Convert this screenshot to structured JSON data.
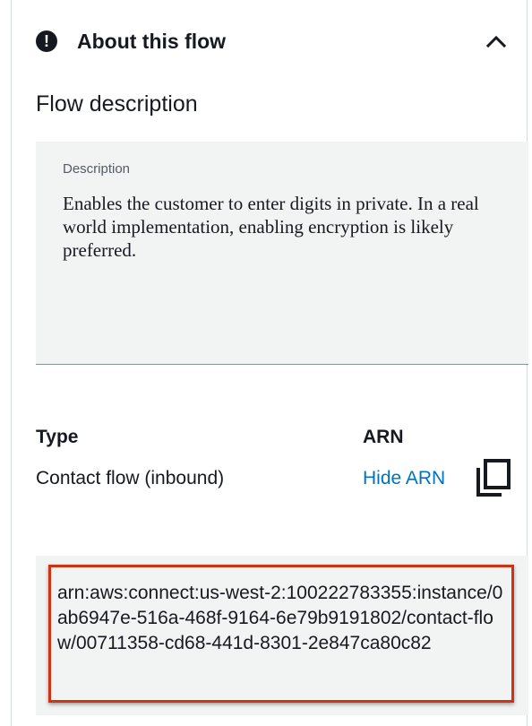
{
  "header": {
    "title": "About this flow",
    "alert_icon_glyph": "!",
    "alert_icon": "exclamation-circle-icon",
    "collapse_icon": "chevron-up-icon"
  },
  "flow_description": {
    "section_label": "Flow description",
    "field_label": "Description",
    "value": "Enables the customer to enter digits in private. In a real world implementation, enabling encryption is likely preferred."
  },
  "details": {
    "type_label": "Type",
    "type_value": "Contact flow (inbound)",
    "arn_label": "ARN",
    "hide_arn_label": "Hide ARN",
    "copy_icon": "copy-icon",
    "arn_value": "arn:aws:connect:us-west-2:100222783355:instance/0ab6947e-516a-468f-9164-6e79b9191802/contact-flow/00711358-cd68-441d-8301-2e847ca80c82"
  },
  "colors": {
    "link": "#0073bb",
    "highlight_border": "#d13212",
    "box_background": "#f2f3f3"
  }
}
